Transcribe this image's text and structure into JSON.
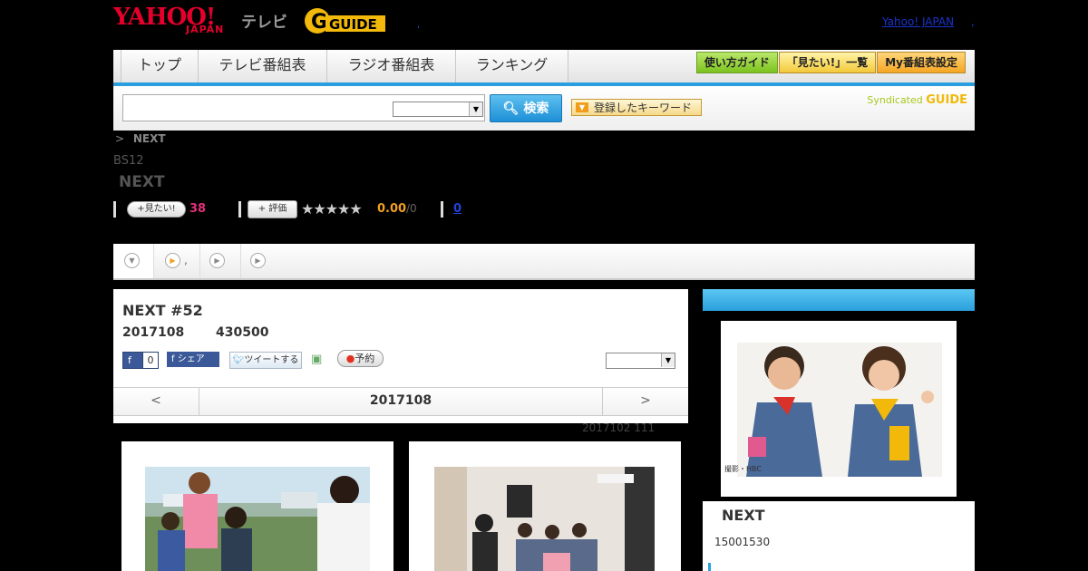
{
  "header": {
    "logo_yahoo": "YAHOO!",
    "logo_japan": "JAPAN",
    "logo_tv": "テレビ",
    "logo_gguide": "G GUIDE",
    "yahoo_link": "Yahoo! JAPAN",
    "link_sep": ","
  },
  "nav": {
    "tabs": [
      {
        "label": "トップ"
      },
      {
        "label": "テレビ番組表"
      },
      {
        "label": "ラジオ番組表"
      },
      {
        "label": "ランキング"
      }
    ],
    "right_buttons": [
      {
        "label": "使い方ガイド"
      },
      {
        "label": "「見たい!」一覧"
      },
      {
        "label": "My番組表設定"
      }
    ]
  },
  "search": {
    "input_value": "",
    "select_value": "",
    "button_label": "検索",
    "keyword_button": "登録したキーワード",
    "syndicated_label": "Syndicated",
    "syndicated_logo": "GUIDE"
  },
  "breadcrumb": {
    "sep": ">",
    "current": "NEXT"
  },
  "program": {
    "channel": "BS12",
    "title": "NEXT",
    "mitai_label": "見たい!",
    "mitai_count": "38",
    "hyoka_label": "評価",
    "stars": "★★★★★",
    "rating": "0.00",
    "rating_of": "/0",
    "comment_count": "0"
  },
  "tabs": [
    {
      "label": ""
    },
    {
      "label": ","
    },
    {
      "label": ""
    },
    {
      "label": ""
    }
  ],
  "episode": {
    "title": "NEXT #52",
    "date": "2017108",
    "time": "430500",
    "fb_like_label": "f",
    "fb_like_count": "0",
    "fb_share_label": "f シェア",
    "tweet_label": "ツイートする",
    "reserve_label": "予約",
    "select_value": "",
    "pager_prev": "<",
    "pager_date": "2017108",
    "pager_next": ">",
    "update_note": "2017102  111"
  },
  "sidebar": {
    "photo_caption": "撮影・HBC",
    "title": "NEXT",
    "time": "15001530"
  },
  "colors": {
    "accent_blue": "#2aa0dc",
    "yahoo_red": "#e4002b",
    "mitai_pink": "#e0307a",
    "rating_orange": "#f0a020",
    "gguide_yellow": "#f2b90a"
  }
}
